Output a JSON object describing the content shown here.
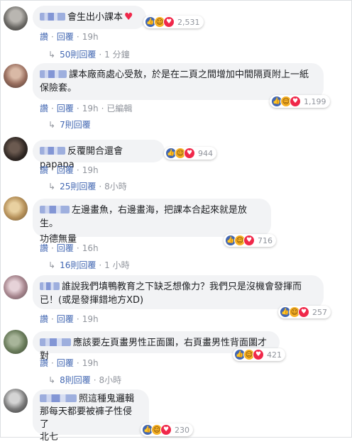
{
  "actions": {
    "like": "讚",
    "reply": "回覆",
    "dot": "·"
  },
  "comments": [
    {
      "text": "會生出小課本",
      "heart": "♥",
      "reactions": "2,531",
      "time": "19h",
      "edited": "",
      "replies": "50則回覆",
      "replies_time": "1 分鐘"
    },
    {
      "text": "課本廠商處心受敖，於是在二頁之間增加中間隔頁附上一紙",
      "text2": "保險套。",
      "reactions": "1,199",
      "time": "19h",
      "edited": "已編輯",
      "replies": "7則回覆",
      "replies_time": ""
    },
    {
      "text": "反覆開合還會papapa",
      "reactions": "944",
      "time": "19h",
      "edited": "",
      "replies": "25則回覆",
      "replies_time": "8小時"
    },
    {
      "text": "左邊畫魚，右邊畫海，把課本合起來就是放生。",
      "text2": "功德無量",
      "reactions": "716",
      "time": "16h",
      "edited": "",
      "replies": "16則回覆",
      "replies_time": "1 小時"
    },
    {
      "text": "誰說我們填鴨教育之下缺乏想像力？我們只是沒機會發揮而",
      "text2": "已！(或是發揮錯地方XD)",
      "reactions": "257",
      "time": "19h",
      "edited": "",
      "replies": "",
      "replies_time": ""
    },
    {
      "text": "應該要左頁畫男性正面圖，右頁畫男性背面圖才對",
      "reactions": "421",
      "time": "19h",
      "edited": "",
      "replies": "8則回覆",
      "replies_time": "8小時"
    },
    {
      "text": "照這種鬼邏輯",
      "text2": "那每天都要被褲子性侵了",
      "text3": "北七",
      "reactions": "230"
    }
  ]
}
